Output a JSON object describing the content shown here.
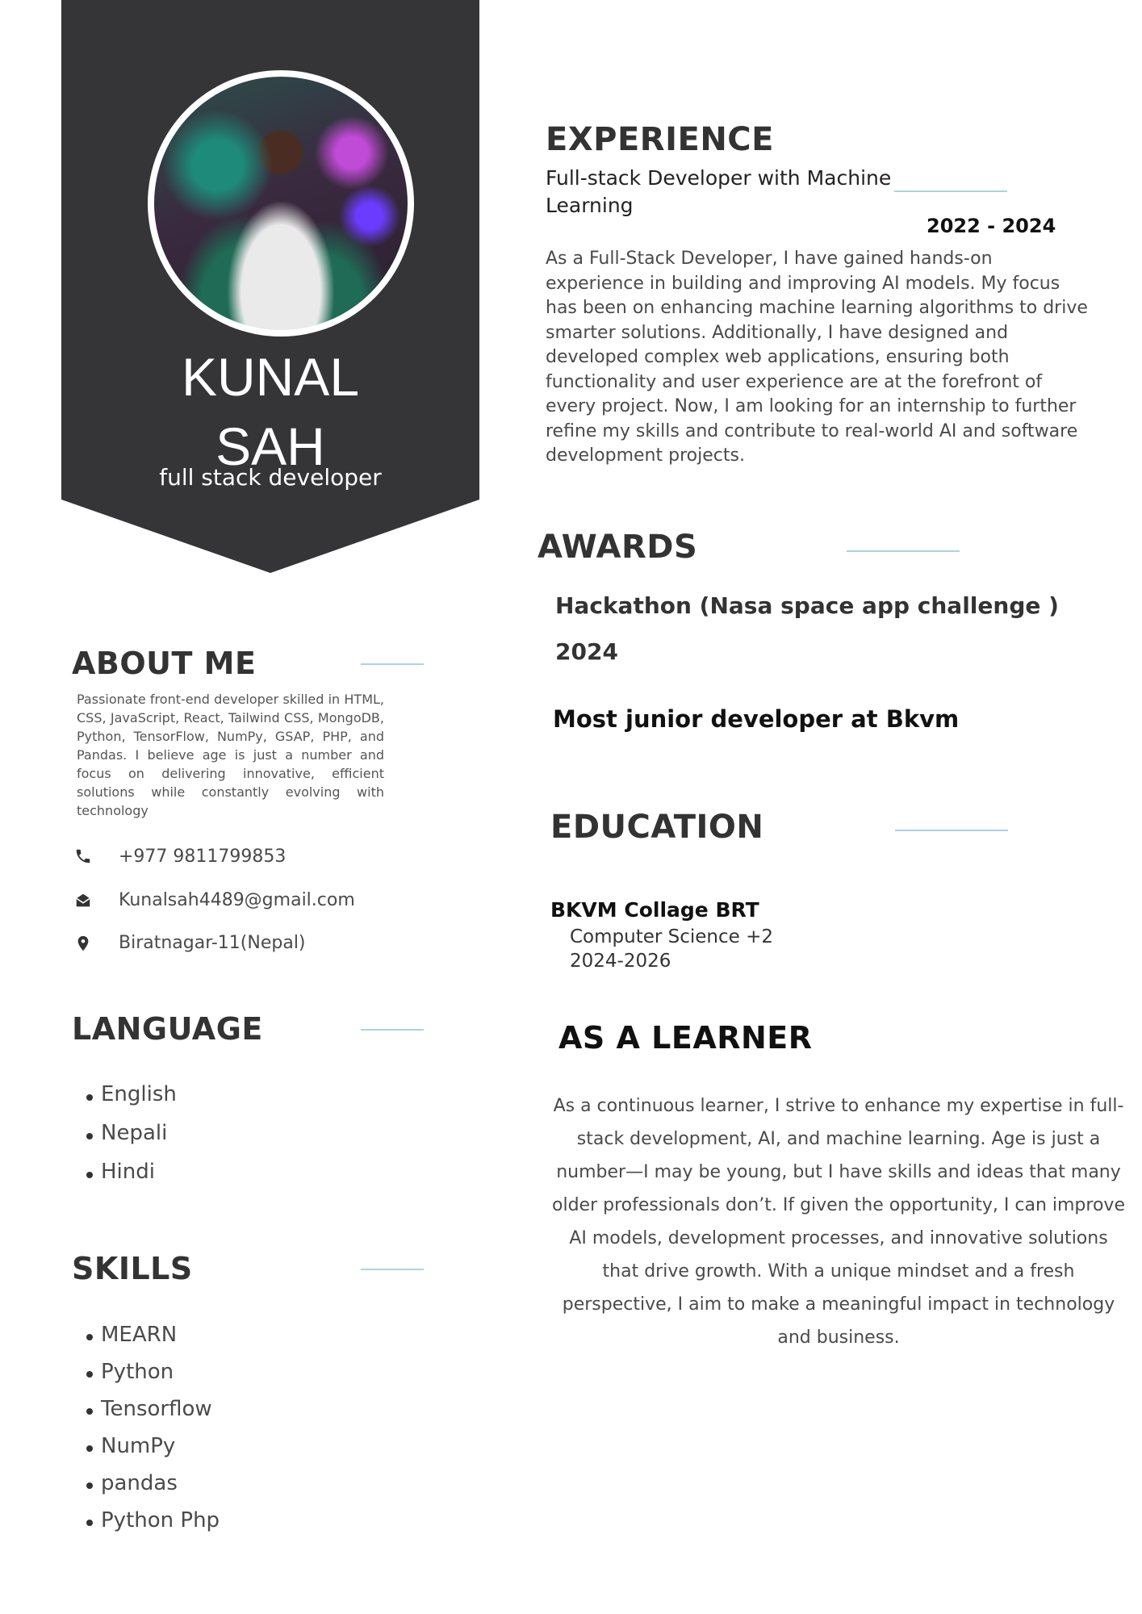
{
  "header": {
    "name_line1": "KUNAL",
    "name_line2": "SAH",
    "role": "full stack developer"
  },
  "about": {
    "title": "ABOUT ME",
    "text": "Passionate front-end developer skilled in HTML, CSS, JavaScript, React, Tailwind CSS, MongoDB, Python, TensorFlow, NumPy, GSAP, PHP, and Pandas. I believe age is just a number and focus on delivering innovative, efficient solutions while constantly evolving with technology"
  },
  "contact": {
    "phone": "+977 9811799853",
    "email": "Kunalsah4489@gmail.com",
    "location": "Biratnagar-11(Nepal)"
  },
  "language": {
    "title": "LANGUAGE",
    "items": [
      "English",
      "Nepali",
      "Hindi"
    ]
  },
  "skills": {
    "title": "SKILLS",
    "items": [
      "MEARN",
      "Python",
      "Tensorflow",
      "NumPy",
      "pandas",
      "Python Php"
    ]
  },
  "experience": {
    "title": "EXPERIENCE",
    "job_line1": "Full-stack Developer with Machine",
    "job_line2": "Learning",
    "years": "2022 - 2024",
    "text": "As a Full-Stack Developer, I have gained hands-on experience in building and improving AI models. My focus has been on enhancing machine learning algorithms to drive smarter solutions. Additionally, I have designed and developed complex web applications, ensuring both functionality and user experience are at the forefront of every project. Now, I am looking for an internship to further refine my skills and contribute to real-world AI and software development projects."
  },
  "awards": {
    "title": "AWARDS",
    "award1": "Hackathon (Nasa space app challenge )",
    "award1_year": "2024",
    "award2": "Most junior developer at Bkvm"
  },
  "education": {
    "title": "EDUCATION",
    "school": "BKVM Collage BRT",
    "program": "Computer Science +2",
    "years": "2024-2026"
  },
  "learner": {
    "title": "AS A LEARNER",
    "text": "As a continuous learner, I strive to enhance my expertise in full-stack development, AI, and machine learning. Age is just a number—I may be young, but I have skills and ideas that many older professionals don’t. If given the opportunity, I can improve AI models, development processes, and innovative solutions that drive growth. With a unique mindset and a fresh perspective, I aim to make a meaningful impact in technology and business."
  },
  "icons": {
    "phone": "phone-icon",
    "email": "envelope-icon",
    "location": "map-pin-icon"
  }
}
